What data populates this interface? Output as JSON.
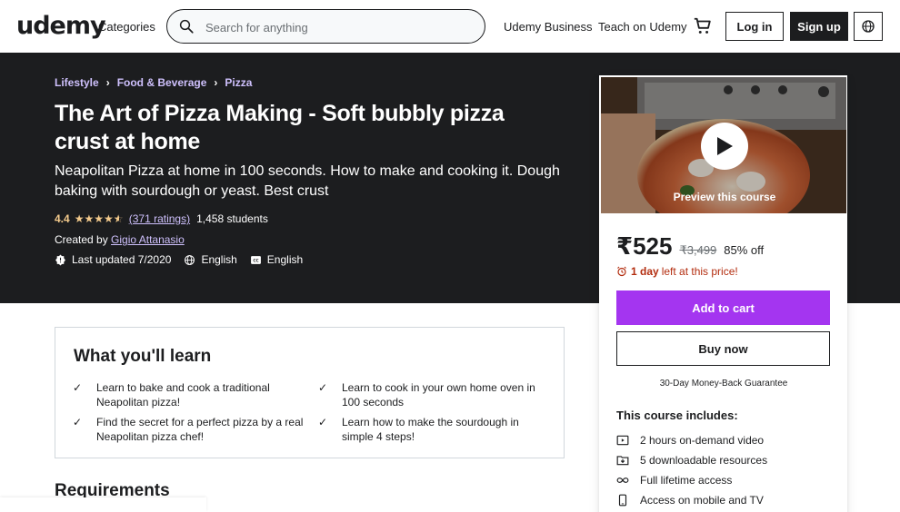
{
  "header": {
    "logo": "udemy",
    "categories": "Categories",
    "search_placeholder": "Search for anything",
    "business": "Udemy Business",
    "teach": "Teach on Udemy",
    "login": "Log in",
    "signup": "Sign up"
  },
  "breadcrumb": [
    "Lifestyle",
    "Food & Beverage",
    "Pizza"
  ],
  "course": {
    "title": "The Art of Pizza Making - Soft bubbly pizza crust at home",
    "subtitle": "Neapolitan Pizza at home in 100 seconds. How to make and cooking it. Dough baking with sourdough or yeast. Best crust",
    "rating": "4.4",
    "stars": 4.4,
    "ratings_link": "(371 ratings)",
    "students": "1,458 students",
    "created_by_label": "Created by",
    "author": "Gigio Attanasio",
    "last_updated": "Last updated 7/2020",
    "language": "English",
    "captions": "English"
  },
  "sidebar": {
    "preview_label": "Preview this course",
    "price": "₹525",
    "old_price": "₹3,499",
    "discount": "85% off",
    "urgency_bold": "1 day",
    "urgency_rest": "left at this price!",
    "add_to_cart": "Add to cart",
    "buy_now": "Buy now",
    "guarantee": "30-Day Money-Back Guarantee",
    "includes_title": "This course includes:",
    "includes": [
      {
        "icon": "video-icon",
        "label": "2 hours on-demand video"
      },
      {
        "icon": "download-icon",
        "label": "5 downloadable resources"
      },
      {
        "icon": "infinity-icon",
        "label": "Full lifetime access"
      },
      {
        "icon": "mobile-icon",
        "label": "Access on mobile and TV"
      }
    ]
  },
  "learn": {
    "title": "What you'll learn",
    "items": [
      "Learn to bake and cook a traditional Neapolitan pizza!",
      "Learn to cook in your own home oven in 100 seconds",
      "Find the secret for a perfect pizza by a real Neapolitan pizza chef!",
      "Learn how to make the sourdough in simple 4 steps!"
    ]
  },
  "requirements_title": "Requirements",
  "colors": {
    "brand": "#a435f0",
    "dark_band": "#1c1d1f",
    "link_purple": "#cec0fc",
    "star": "#f3ca8c",
    "urgency": "#b32d0f"
  }
}
